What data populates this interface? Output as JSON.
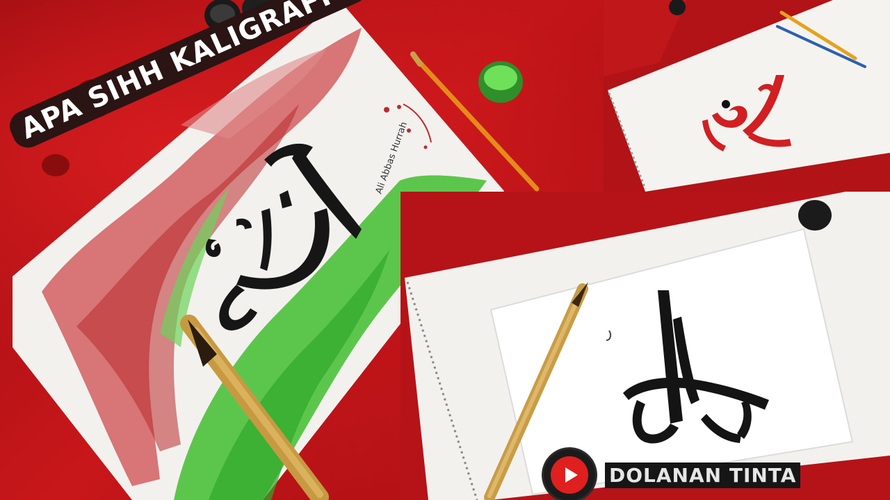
{
  "title": "APA SIHH KALIGRAFI ?",
  "channel": {
    "name": "DOLANAN TINTA",
    "logo_icon": "play-icon"
  },
  "artwork": {
    "signature": "Ali Abbas Hurrah"
  },
  "colors": {
    "background": "#b51317",
    "title_bg": "#2a1414",
    "title_text": "#ffffff",
    "channel_bg": "#161616",
    "channel_text": "#e6e6e6",
    "logo_red": "#e01f1f"
  }
}
